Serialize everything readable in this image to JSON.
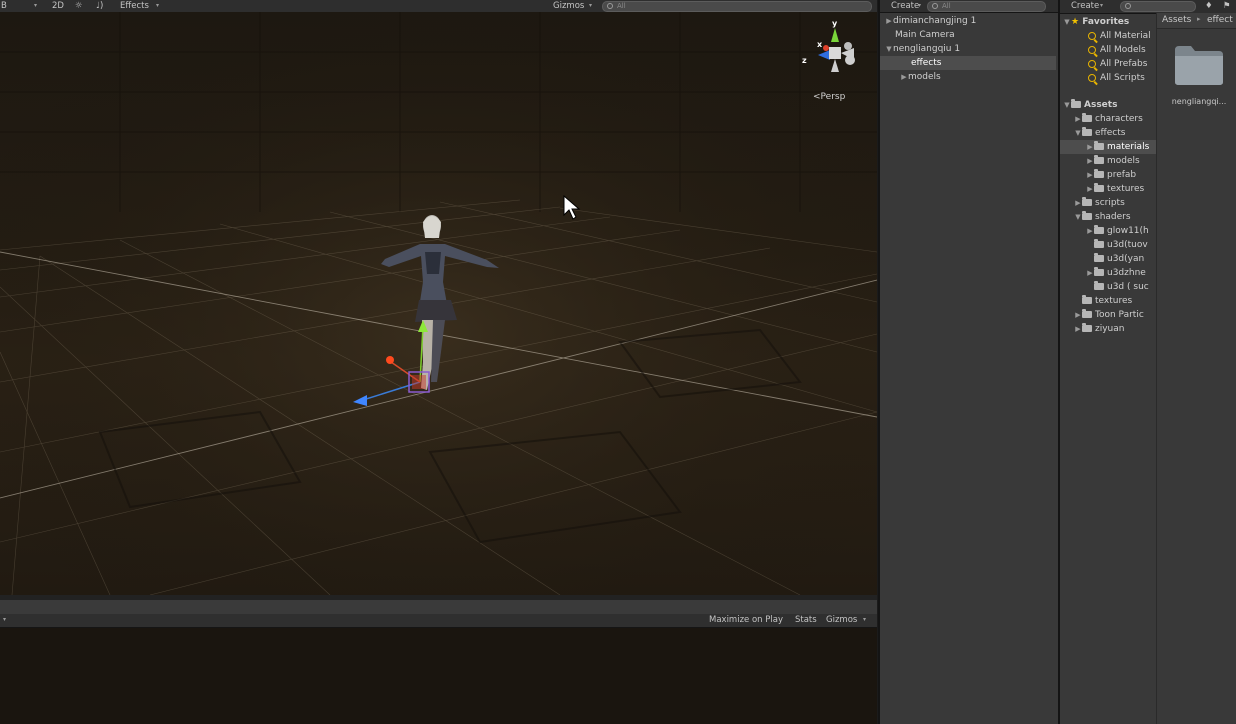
{
  "scene_toolbar": {
    "shading_short": "B",
    "mode_2d": "2D",
    "effects_label": "Effects",
    "gizmos_label": "Gizmos",
    "search_placeholder": "All"
  },
  "scene_gizmo": {
    "axis_y": "y",
    "axis_x": "x",
    "axis_z": "z",
    "persp_label": "Persp"
  },
  "game_toolbar": {
    "maximize_label": "Maximize on Play",
    "stats_label": "Stats",
    "gizmos_label": "Gizmos"
  },
  "hierarchy": {
    "create_label": "Create",
    "search_placeholder": "All",
    "items": [
      {
        "label": "dimianchangjing 1",
        "expanded": false
      },
      {
        "label": "Main Camera"
      },
      {
        "label": "nengliangqiu 1",
        "expanded": true
      },
      {
        "label": "effects",
        "selected": true
      },
      {
        "label": "models",
        "expanded": false
      }
    ]
  },
  "project": {
    "create_label": "Create",
    "favorites_label": "Favorites",
    "favorites": [
      "All Material",
      "All Models",
      "All Prefabs",
      "All Scripts"
    ],
    "assets_label": "Assets",
    "tree": [
      "characters",
      "effects",
      "materials",
      "models",
      "prefab",
      "textures",
      "scripts",
      "shaders",
      "glow11(h",
      "u3d(tuov",
      "u3d(yan",
      "u3dzhne",
      "u3d ( suc",
      "textures",
      "Toon Partic",
      "ziyuan"
    ],
    "breadcrumb": [
      "Assets",
      "effect"
    ],
    "grid_items": [
      "nengliangqi..."
    ]
  }
}
